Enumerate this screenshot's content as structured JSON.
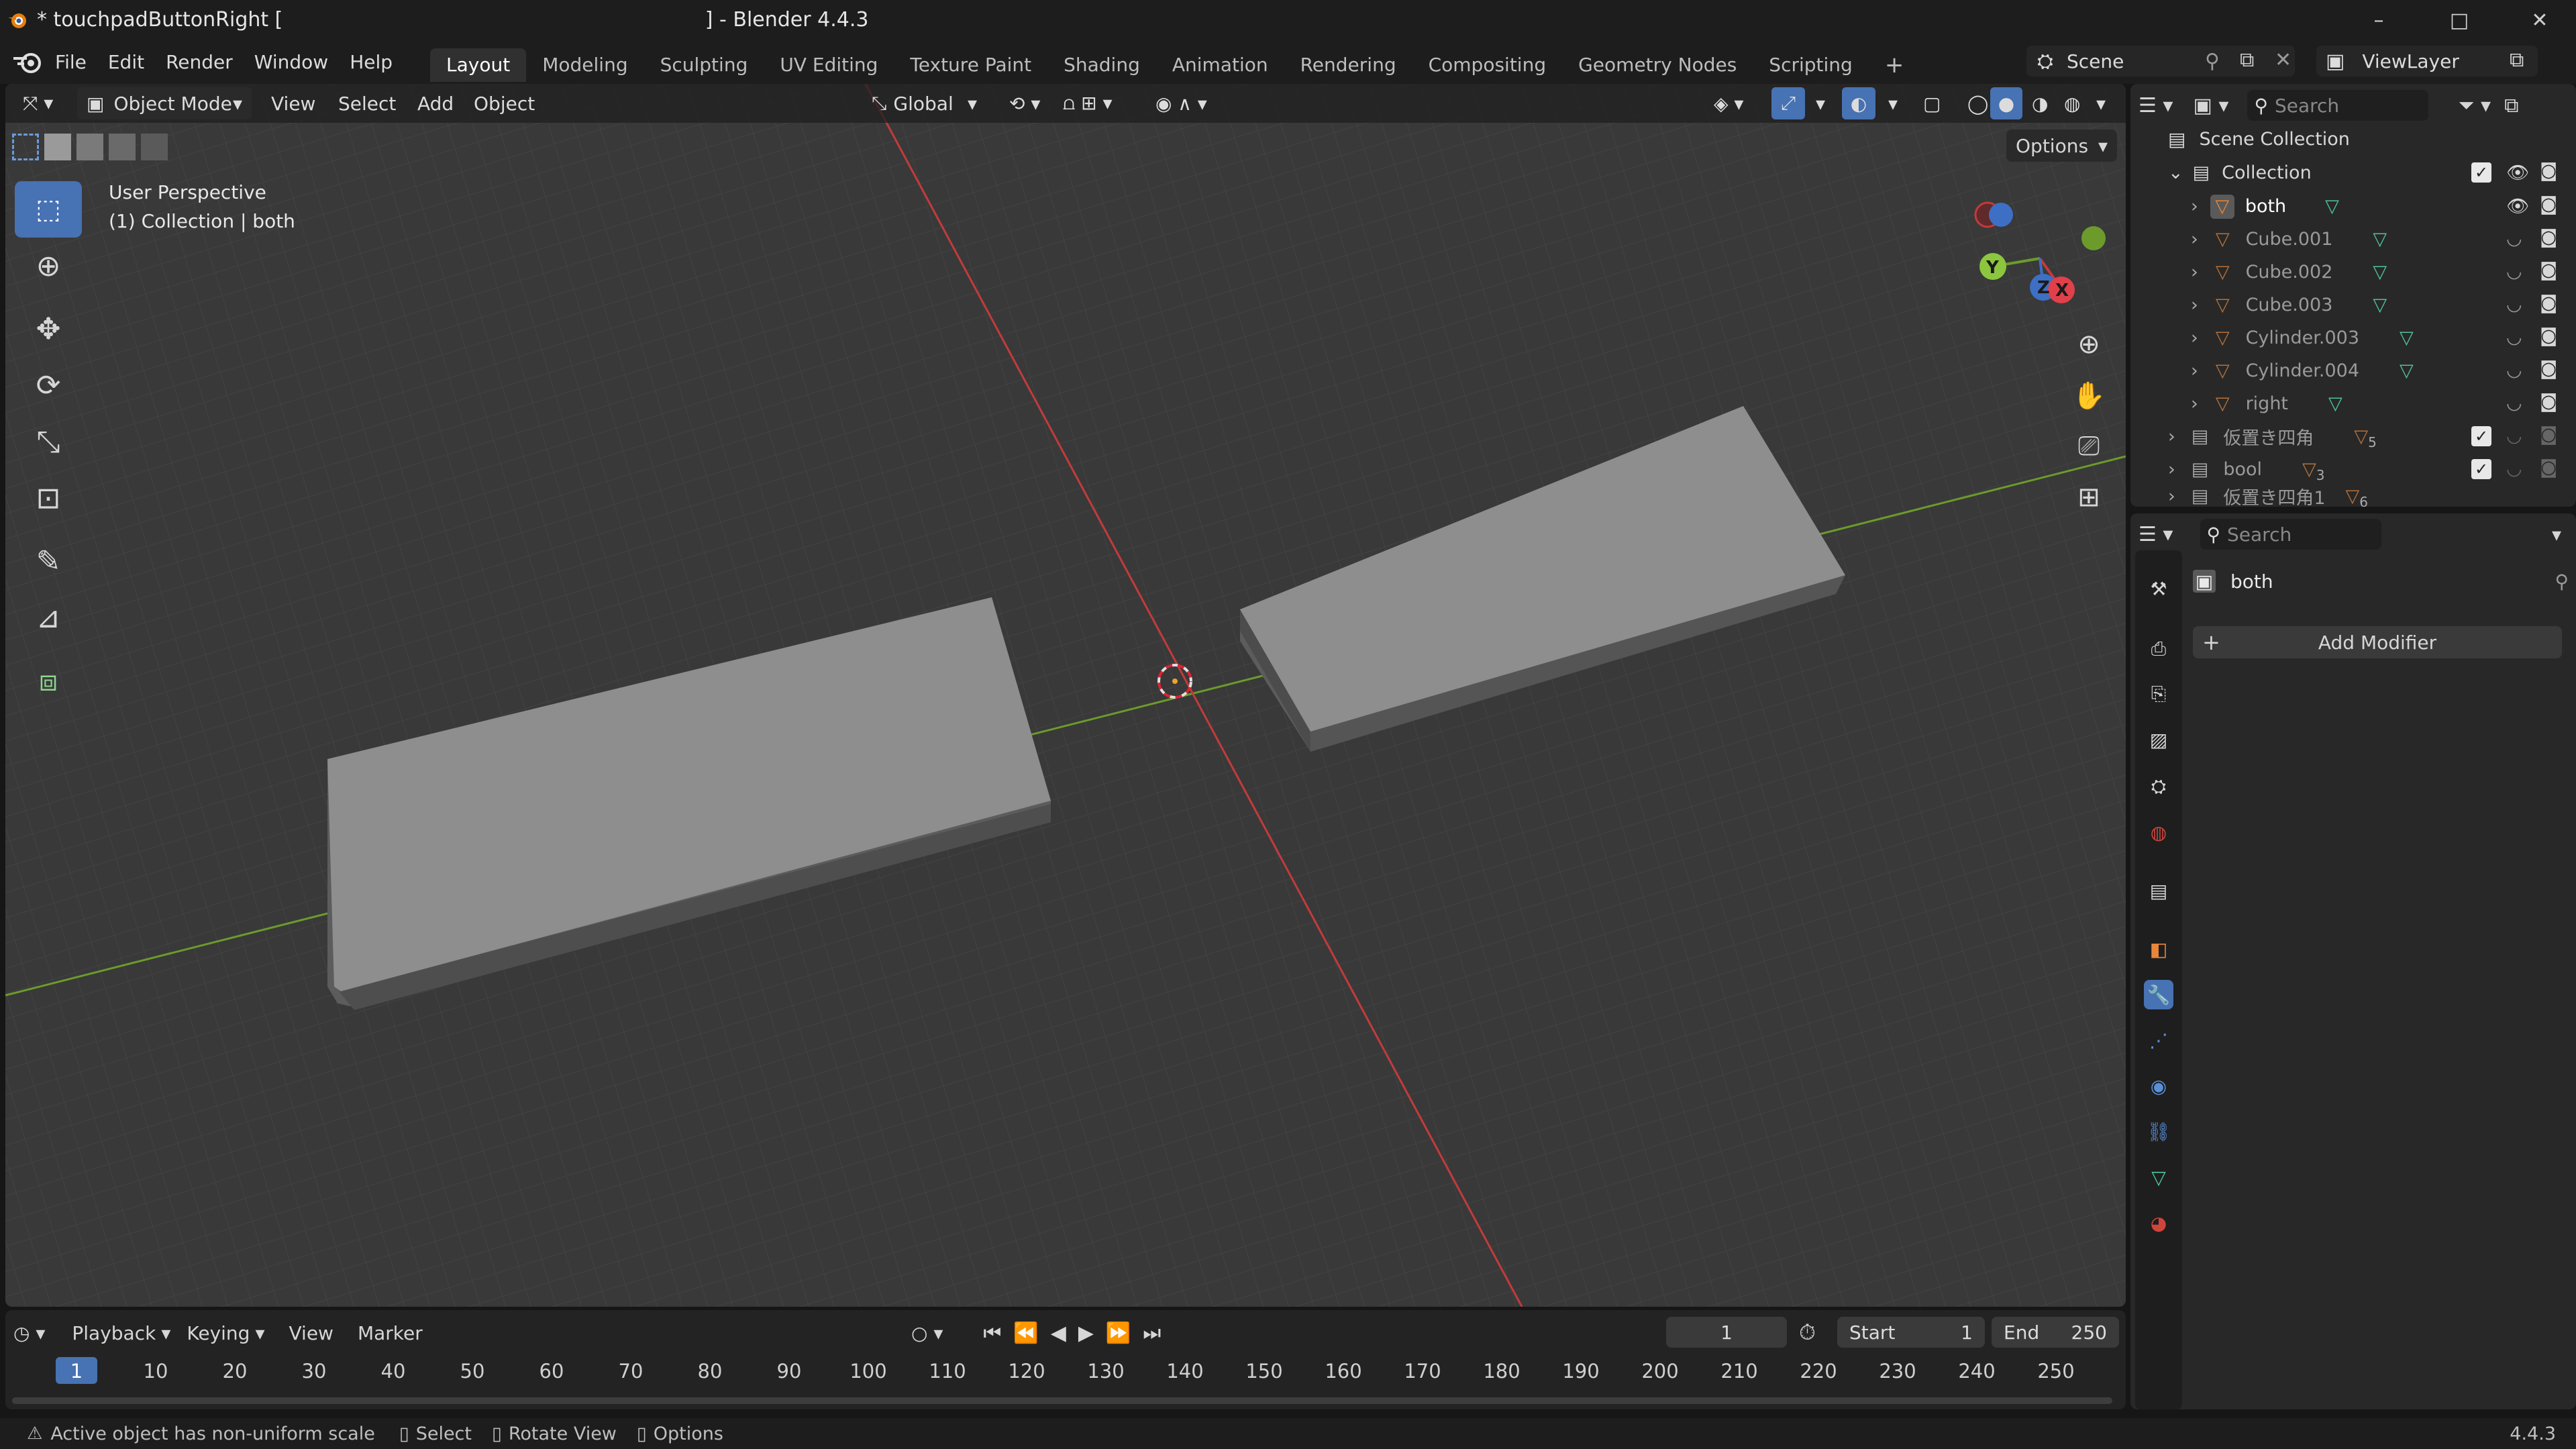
{
  "window": {
    "title": "* touchpadButtonRight [                                                                  ] - Blender 4.4.3",
    "minimize": "–",
    "maximize": "□",
    "close": "✕"
  },
  "menus": [
    "File",
    "Edit",
    "Render",
    "Window",
    "Help"
  ],
  "workspaces": {
    "active": "Layout",
    "tabs": [
      "Layout",
      "Modeling",
      "Sculpting",
      "UV Editing",
      "Texture Paint",
      "Shading",
      "Animation",
      "Rendering",
      "Compositing",
      "Geometry Nodes",
      "Scripting"
    ],
    "add": "+"
  },
  "scene": {
    "name": "Scene",
    "view_layer": "ViewLayer"
  },
  "viewport": {
    "mode": "Object Mode",
    "menus": [
      "View",
      "Select",
      "Add",
      "Object"
    ],
    "transform_orientation": "Global",
    "options": "Options",
    "overlay_title": "User Perspective",
    "overlay_subtitle": "(1) Collection | both",
    "gizmo": {
      "x": "X",
      "y": "Y",
      "z": "Z"
    }
  },
  "outliner": {
    "search_placeholder": "Search",
    "scene_collection": "Scene Collection",
    "collection": "Collection",
    "items": [
      {
        "label": "both",
        "active": true
      },
      {
        "label": "Cube.001",
        "active": false
      },
      {
        "label": "Cube.002",
        "active": false
      },
      {
        "label": "Cube.003",
        "active": false
      },
      {
        "label": "Cylinder.003",
        "active": false
      },
      {
        "label": "Cylinder.004",
        "active": false
      },
      {
        "label": "right",
        "active": false
      }
    ],
    "subcollections": [
      {
        "label": "仮置き四角",
        "count": "5"
      },
      {
        "label": "bool",
        "count": "3"
      },
      {
        "label": "仮置き四角1",
        "count": "6"
      }
    ]
  },
  "properties": {
    "search_placeholder": "Search",
    "object_name": "both",
    "add_modifier": "Add Modifier"
  },
  "timeline": {
    "menus": [
      "Playback",
      "Keying",
      "View",
      "Marker"
    ],
    "current_frame": "1",
    "start_label": "Start",
    "start": "1",
    "end_label": "End",
    "end": "250",
    "frame_labels": [
      "1",
      "10",
      "20",
      "30",
      "40",
      "50",
      "60",
      "70",
      "80",
      "90",
      "100",
      "110",
      "120",
      "130",
      "140",
      "150",
      "160",
      "170",
      "180",
      "190",
      "200",
      "210",
      "220",
      "230",
      "240",
      "250"
    ]
  },
  "statusbar": {
    "warning": "Active object has non-uniform scale",
    "hint_select": "Select",
    "hint_rotate": "Rotate View",
    "hint_options": "Options",
    "version": "4.4.3"
  },
  "colors": {
    "accent": "#4772b3",
    "x_axis": "#c23b3b",
    "y_axis": "#6c9b2c",
    "z_axis": "#3d6fc4",
    "mesh_icon": "#4fc2a0",
    "object_icon": "#e8873a"
  }
}
